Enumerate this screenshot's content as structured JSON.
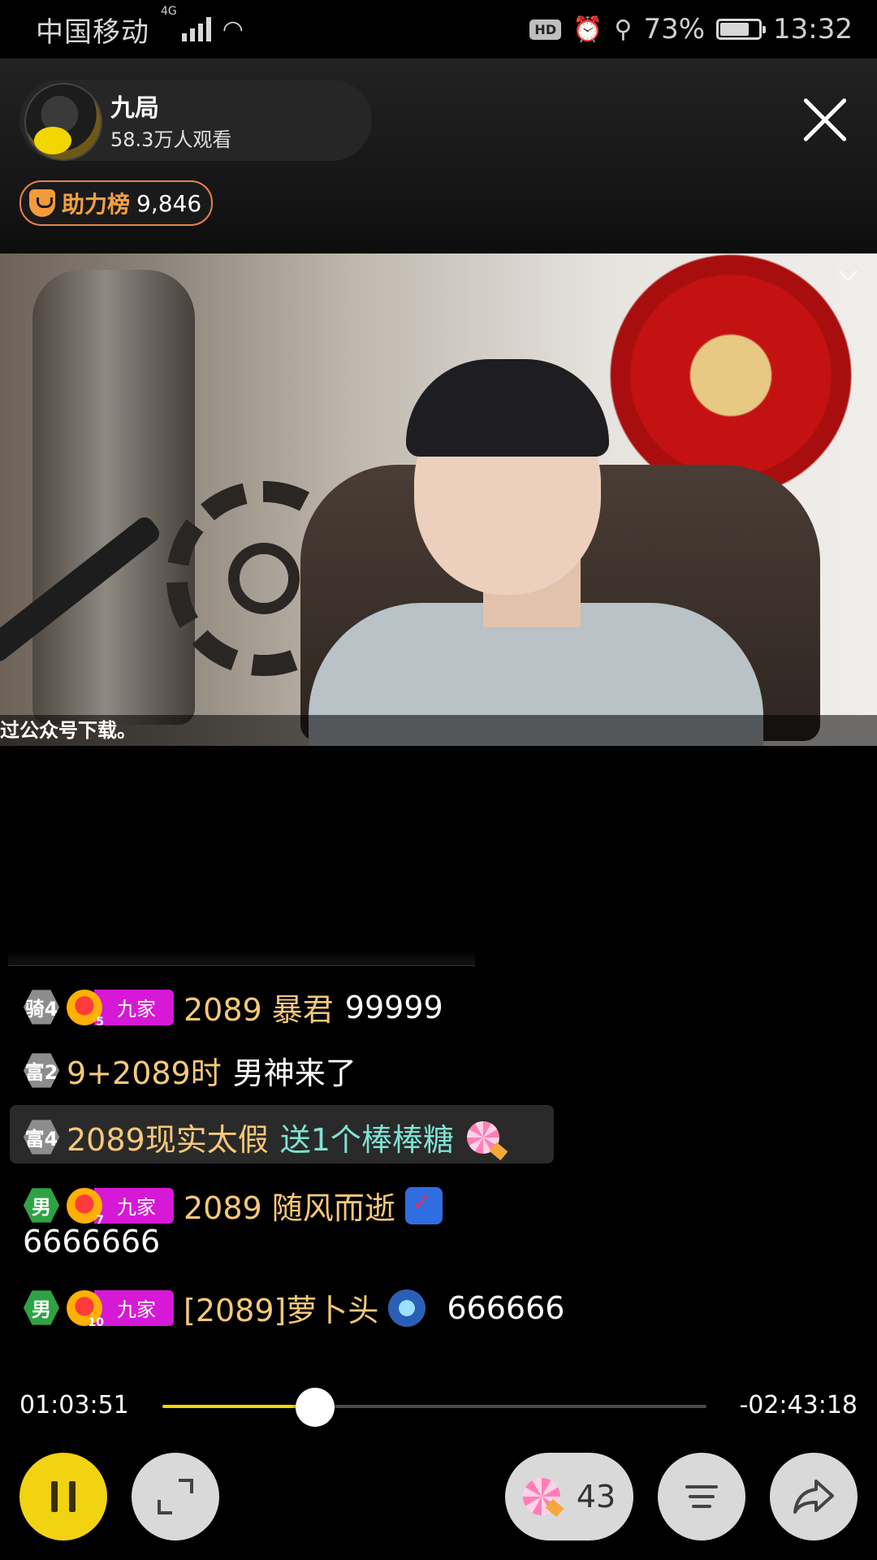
{
  "status_bar": {
    "carrier": "中国移动",
    "network": "4G",
    "hd": "HD",
    "battery": "73%",
    "time": "13:32"
  },
  "header": {
    "host_name": "九局",
    "viewers": "58.3万人观看",
    "rank_label": "助力榜",
    "rank_value": "9,846"
  },
  "video": {
    "caption": "过公众号下载。"
  },
  "chat": {
    "messages": [
      {
        "level": "骑4",
        "club": "九家",
        "fan_level": "5",
        "user": "2089  暴君",
        "text": "99999"
      },
      {
        "level": "富2",
        "user": "9+2089时",
        "text": "男神来了"
      },
      {
        "level": "富4",
        "user": "2089现实太假",
        "gift": "送1个棒棒糖"
      },
      {
        "level": "男",
        "club": "九家",
        "fan_level": "7",
        "user": "2089 随风而逝",
        "badge": "5",
        "text": "6666666"
      },
      {
        "level": "男",
        "club": "九家",
        "fan_level": "10",
        "user": "[2089]萝卜头",
        "text": "666666"
      }
    ]
  },
  "player": {
    "elapsed": "01:03:51",
    "remaining": "-02:43:18",
    "progress": 0.28
  },
  "controls": {
    "gift_count": "43"
  },
  "colors": {
    "accent_yellow": "#f2d312",
    "rank_orange": "#f4a143",
    "username_gold": "#f6c978",
    "gift_teal": "#7fe2d2",
    "club_magenta": "#d619d6"
  }
}
